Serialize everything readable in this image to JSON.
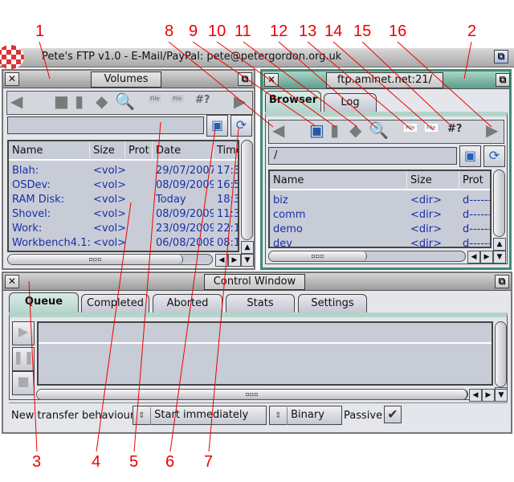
{
  "screen": {
    "title": "Pete's FTP v1.0 - E-Mail/PayPal: pete@petergordon.org.uk"
  },
  "volumes": {
    "title": "Volumes",
    "path": "",
    "columns": [
      "Name",
      "Size",
      "Prot",
      "Date",
      "Time"
    ],
    "rows": [
      {
        "name": "Blah:",
        "size": "<vol>",
        "prot": "",
        "date": "29/07/2007",
        "time": "17:3"
      },
      {
        "name": "OSDev:",
        "size": "<vol>",
        "prot": "",
        "date": "08/09/2009",
        "time": "16:5"
      },
      {
        "name": "RAM Disk:",
        "size": "<vol>",
        "prot": "",
        "date": "Today",
        "time": "18:3"
      },
      {
        "name": "Shovel:",
        "size": "<vol>",
        "prot": "",
        "date": "08/09/2009",
        "time": "11:3"
      },
      {
        "name": "Work:",
        "size": "<vol>",
        "prot": "",
        "date": "23/09/2009",
        "time": "22:1"
      },
      {
        "name": "Workbench4.1:",
        "size": "<vol>",
        "prot": "",
        "date": "06/08/2008",
        "time": "08:1"
      }
    ]
  },
  "remote": {
    "title": "ftp.aminet.net:21/",
    "tabs": [
      "Browser",
      "Log"
    ],
    "path": "/",
    "columns": [
      "Name",
      "Size",
      "Prot"
    ],
    "rows": [
      {
        "name": "biz",
        "size": "<dir>",
        "prot": "d------"
      },
      {
        "name": "comm",
        "size": "<dir>",
        "prot": "d------"
      },
      {
        "name": "demo",
        "size": "<dir>",
        "prot": "d------"
      },
      {
        "name": "dev",
        "size": "<dir>",
        "prot": "d------"
      }
    ]
  },
  "control": {
    "title": "Control Window",
    "tabs": [
      "Queue",
      "Completed",
      "Aborted",
      "Stats",
      "Settings"
    ],
    "transfer_label": "New transfer behaviour",
    "transfer_value": "Start immediately",
    "mode_value": "Binary",
    "passive_label": "Passive",
    "passive_checked": true
  },
  "toolbar": {
    "file_label": "File",
    "pattern_label": "#?"
  },
  "annotations": {
    "top": [
      "1",
      "8",
      "9",
      "10",
      "11",
      "12",
      "13",
      "14",
      "15",
      "16",
      "2"
    ],
    "bottom": [
      "3",
      "4",
      "5",
      "6",
      "7"
    ]
  },
  "colors": {
    "accent": "#3f8a78",
    "list_text": "#1a2fa8",
    "annotation": "#ee0000"
  }
}
